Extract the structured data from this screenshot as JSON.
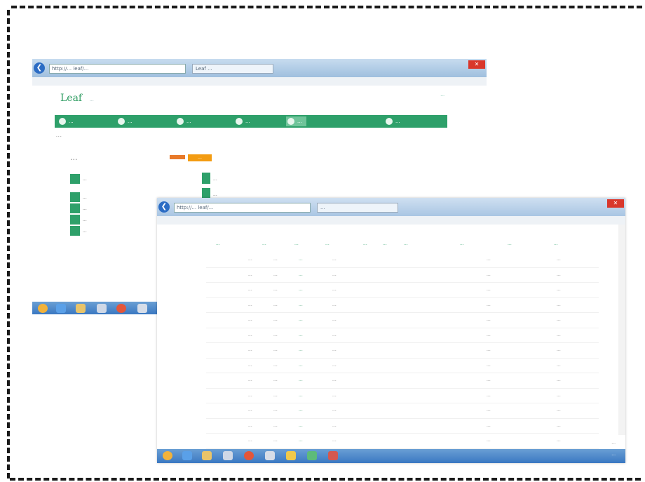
{
  "window1": {
    "address": "http://... leaf/...",
    "tab": "Leaf ...",
    "logo": "Leaf",
    "logo_sub": "...",
    "top_right": "...",
    "nav": [
      {
        "label": "..."
      },
      {
        "label": "..."
      },
      {
        "label": "..."
      },
      {
        "label": "..."
      },
      {
        "label": "..."
      },
      {
        "label": "..."
      }
    ],
    "subnav": "...",
    "page_title": "...",
    "badge": "...",
    "side_items": [
      "...",
      "...",
      "...",
      "...",
      "..."
    ],
    "mid_items": [
      "...",
      "..."
    ]
  },
  "window2": {
    "address": "http://... leaf/...",
    "tab": "...",
    "columns": [
      "...",
      "...",
      "...",
      "...",
      "...",
      "...",
      "...",
      "...",
      "...",
      "..."
    ],
    "rows": [
      {
        "c1": "...",
        "c2": "...",
        "c3": "...",
        "c4": "...",
        "c5": "...",
        "c6": "..."
      },
      {
        "c1": "...",
        "c2": "...",
        "c3": "...",
        "c4": "...",
        "c5": "...",
        "c6": "..."
      },
      {
        "c1": "...",
        "c2": "...",
        "c3": "...",
        "c4": "...",
        "c5": "...",
        "c6": "..."
      },
      {
        "c1": "...",
        "c2": "...",
        "c3": "...",
        "c4": "...",
        "c5": "...",
        "c6": "..."
      },
      {
        "c1": "...",
        "c2": "...",
        "c3": "...",
        "c4": "...",
        "c5": "...",
        "c6": "..."
      },
      {
        "c1": "...",
        "c2": "...",
        "c3": "...",
        "c4": "...",
        "c5": "...",
        "c6": "..."
      },
      {
        "c1": "...",
        "c2": "...",
        "c3": "...",
        "c4": "...",
        "c5": "...",
        "c6": "..."
      },
      {
        "c1": "...",
        "c2": "...",
        "c3": "...",
        "c4": "...",
        "c5": "...",
        "c6": "..."
      },
      {
        "c1": "...",
        "c2": "...",
        "c3": "...",
        "c4": "...",
        "c5": "...",
        "c6": "..."
      },
      {
        "c1": "...",
        "c2": "...",
        "c3": "...",
        "c4": "...",
        "c5": "...",
        "c6": "..."
      },
      {
        "c1": "...",
        "c2": "...",
        "c3": "...",
        "c4": "...",
        "c5": "...",
        "c6": "..."
      },
      {
        "c1": "...",
        "c2": "...",
        "c3": "...",
        "c4": "...",
        "c5": "...",
        "c6": "..."
      },
      {
        "c1": "...",
        "c2": "...",
        "c3": "...",
        "c4": "...",
        "c5": "...",
        "c6": "..."
      }
    ],
    "pager": "...",
    "clock": "..."
  },
  "colors": {
    "brand_green": "#2ea06a",
    "badge_orange": "#f39c12",
    "taskbar_blue": "#3a78c2"
  }
}
